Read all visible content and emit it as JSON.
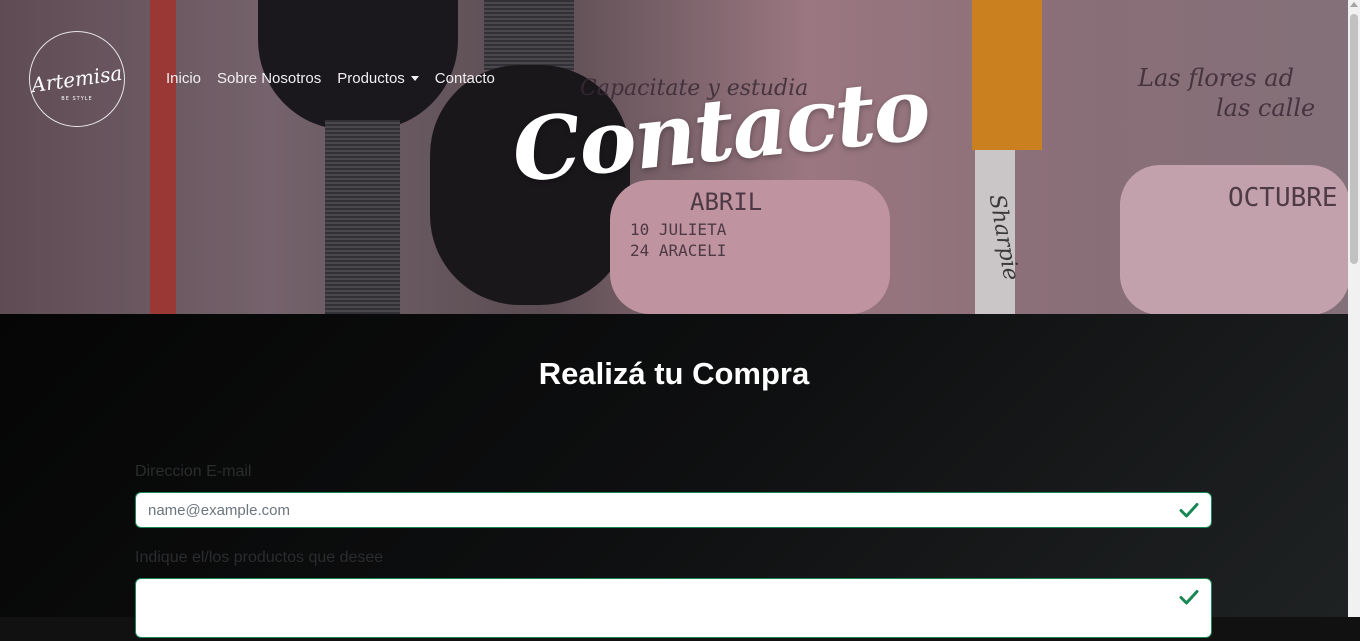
{
  "brand": {
    "logo_text": "Artemisa",
    "logo_sub": "BE STYLE"
  },
  "nav": {
    "items": [
      {
        "label": "Inicio"
      },
      {
        "label": "Sobre Nosotros"
      },
      {
        "label": "Productos"
      },
      {
        "label": "Contacto"
      }
    ]
  },
  "hero": {
    "title": "Contacto",
    "background_words": {
      "line1": "Capacitate y estudia",
      "line2": "Las flores ad",
      "line3": "las calle",
      "month1": "ABRIL",
      "month2": "OCTUBRE",
      "entry1": "10 JULIETA",
      "entry2": "24 ARACELI",
      "marker": "Sharpie"
    }
  },
  "form": {
    "title": "Realizá tu Compra",
    "email_label": "Direccion E-mail",
    "email_placeholder": "name@example.com",
    "products_label": "Indique el/los productos que desee",
    "products_value": ""
  },
  "colors": {
    "valid_border": "#198754",
    "check": "#198754",
    "section_bg": "#0b0c0d"
  }
}
